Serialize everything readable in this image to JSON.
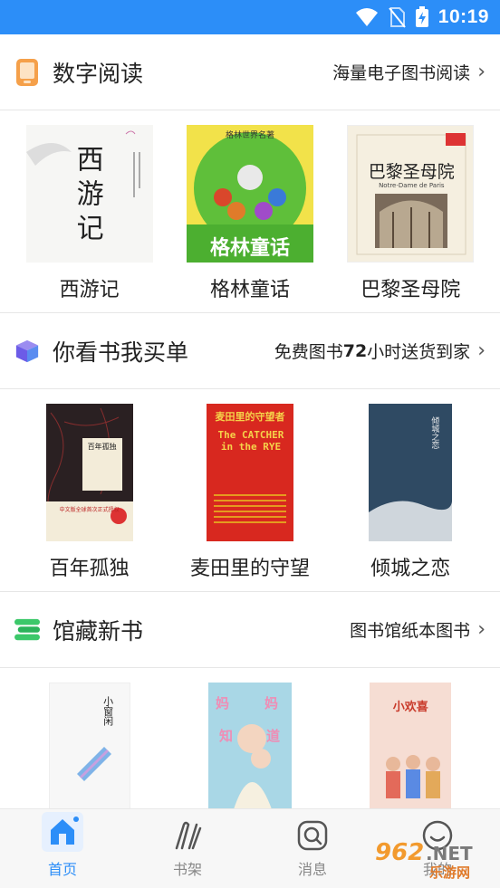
{
  "status_bar": {
    "time": "10:19"
  },
  "sections": [
    {
      "title": "数字阅读",
      "more": "海量电子图书阅读",
      "icon": "phone-icon",
      "books": [
        {
          "title": "西游记"
        },
        {
          "title": "格林童话"
        },
        {
          "title": "巴黎圣母院"
        }
      ]
    },
    {
      "title": "你看书我买单",
      "more_prefix": "免费图书",
      "more_number": "72",
      "more_suffix": "小时送货到家",
      "icon": "box-icon",
      "books": [
        {
          "title": "百年孤独"
        },
        {
          "title": "麦田里的守望"
        },
        {
          "title": "倾城之恋"
        }
      ]
    },
    {
      "title": "馆藏新书",
      "more": "图书馆纸本图书",
      "icon": "stack-icon",
      "books": [
        {
          "title": "小窗闲"
        },
        {
          "title": "妈妈知道怎么办"
        },
        {
          "title": "小欢喜"
        }
      ]
    }
  ],
  "covers": {
    "xiyouji": "西游记",
    "grimm_top": "格林世界名著",
    "grimm_title": "格林童话",
    "notre_dame_title": "巴黎圣母院",
    "notre_dame_sub": "Notre-Dame de Paris",
    "solitude_title": "百年孤独",
    "solitude_band": "中文版全球首次正式授权",
    "catcher_cn": "麦田里的守望者",
    "catcher_en": "The CATCHER in the RYE",
    "fallen_city": "倾城之恋",
    "new1": "小窗闲",
    "new2_a": "妈",
    "new2_b": "妈",
    "new2_c": "知",
    "new2_d": "道",
    "new3": "小欢喜"
  },
  "tabs": [
    {
      "label": "首页",
      "icon": "home-icon",
      "active": true
    },
    {
      "label": "书架",
      "icon": "bookshelf-icon",
      "active": false
    },
    {
      "label": "消息",
      "icon": "message-icon",
      "active": false
    },
    {
      "label": "我的",
      "icon": "profile-icon",
      "active": false
    }
  ],
  "watermark": {
    "text1": "962",
    "text2": ".NET",
    "text3": "乐游网"
  },
  "colors": {
    "accent": "#2c8ef8",
    "status_bar": "#2c8ef8",
    "tab_inactive": "#888888"
  }
}
